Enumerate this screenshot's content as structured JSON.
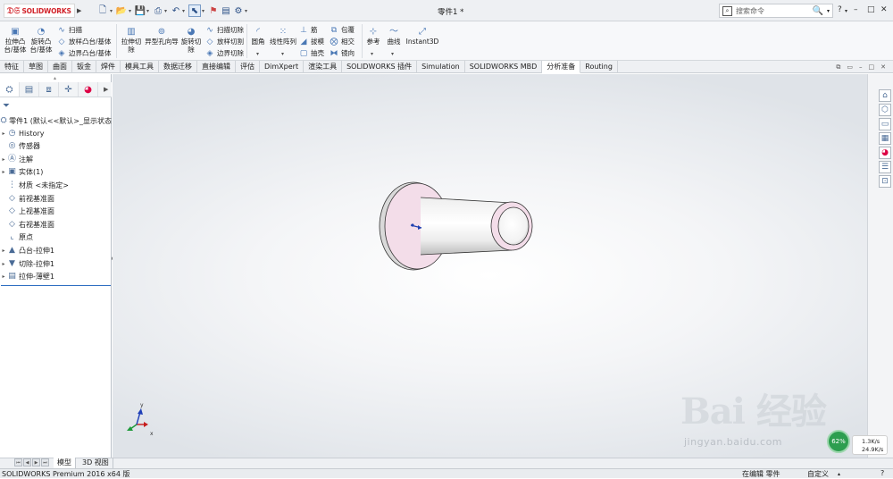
{
  "app": {
    "brand": "SOLIDWORKS",
    "window_title": "零件1 *",
    "search_placeholder": "搜索命令"
  },
  "ribbon": {
    "group1": {
      "extrude_boss": "拉伸凸\n台/基体",
      "revolve_boss": "旋转凸\n台/基体",
      "sweep": "扫描",
      "loft": "放样凸台/基体",
      "boundary": "边界凸台/基体"
    },
    "group2": {
      "extrude_cut": "拉伸切\n除",
      "hole_wizard": "异型孔向导",
      "revolve_cut": "旋转切\n除",
      "swept_cut": "扫描切除",
      "lofted_cut": "放样切割",
      "boundary_cut": "边界切除"
    },
    "group3": {
      "fillet": "圆角",
      "linear_pattern": "线性阵列",
      "rib": "筋",
      "draft": "拔模",
      "shell": "抽壳",
      "wrap": "包覆",
      "intersect": "相交",
      "mirror": "镜向"
    },
    "group4": {
      "reference": "参考",
      "curves": "曲线",
      "instant3d": "Instant3D"
    }
  },
  "tabs": [
    "特征",
    "草图",
    "曲面",
    "钣金",
    "焊件",
    "模具工具",
    "数据迁移",
    "直接编辑",
    "评估",
    "DimXpert",
    "渲染工具",
    "SOLIDWORKS 插件",
    "Simulation",
    "SOLIDWORKS MBD",
    "分析准备",
    "Routing"
  ],
  "active_tab": "分析准备",
  "tree": {
    "root": "零件1 (默认<<默认>_显示状态",
    "items": [
      {
        "label": "History",
        "icon": "history-icon",
        "exp": "▸"
      },
      {
        "label": "传感器",
        "icon": "sensor-icon",
        "exp": ""
      },
      {
        "label": "注解",
        "icon": "annotation-icon",
        "exp": "▸"
      },
      {
        "label": "实体(1)",
        "icon": "solid-bodies-icon",
        "exp": "▸"
      },
      {
        "label": "材质 <未指定>",
        "icon": "material-icon",
        "exp": ""
      },
      {
        "label": "前视基准面",
        "icon": "plane-icon",
        "exp": ""
      },
      {
        "label": "上视基准面",
        "icon": "plane-icon",
        "exp": ""
      },
      {
        "label": "右视基准面",
        "icon": "plane-icon",
        "exp": ""
      },
      {
        "label": "原点",
        "icon": "origin-icon",
        "exp": ""
      },
      {
        "label": "凸台-拉伸1",
        "icon": "boss-extrude-icon",
        "exp": "▸"
      },
      {
        "label": "切除-拉伸1",
        "icon": "cut-extrude-icon",
        "exp": "▸"
      },
      {
        "label": "拉伸-薄壁1",
        "icon": "thin-extrude-icon",
        "exp": "▸"
      }
    ]
  },
  "bottom_tabs": [
    "模型",
    "3D 视图"
  ],
  "status": {
    "version": "SOLIDWORKS Premium 2016 x64 版",
    "editing": "在编辑 零件",
    "custom": "自定义"
  },
  "net_widget": {
    "percent": "62%",
    "up": "1.3K/s",
    "down": "24.9K/s"
  },
  "watermark": {
    "text": "Bai 经验",
    "url": "jingyan.baidu.com"
  },
  "colors": {
    "accent": "#2f6fc2",
    "brand_red": "#d2232a",
    "flange_face": "#f3dde9"
  }
}
